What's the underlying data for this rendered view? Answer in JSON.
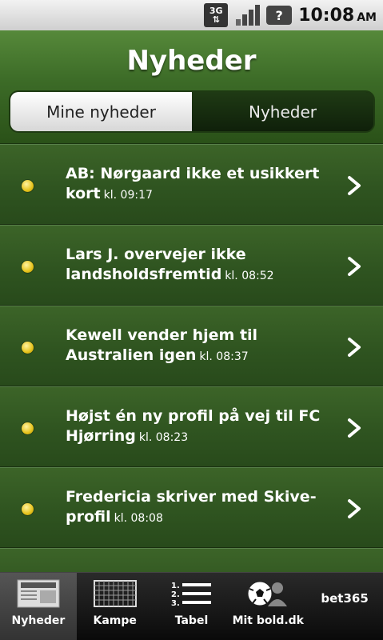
{
  "status": {
    "network": "3G",
    "battery_icon": "battery-unknown-icon",
    "time": "10:08",
    "ampm": "AM"
  },
  "header": {
    "title": "Nyheder",
    "segments": [
      "Mine nyheder",
      "Nyheder"
    ],
    "selected_segment": "Mine nyheder"
  },
  "news": [
    {
      "headline": "AB: Nørgaard ikke et usikkert kort",
      "time": "kl. 09:17"
    },
    {
      "headline": "Lars J. overvejer ikke landsholdsfremtid",
      "time": "kl. 08:52"
    },
    {
      "headline": "Kewell vender hjem til Australien igen",
      "time": "kl. 08:37"
    },
    {
      "headline": "Højst én ny profil på vej til FC Hjørring",
      "time": "kl. 08:23"
    },
    {
      "headline": "Fredericia skriver med Skive-profil",
      "time": "kl. 08:08"
    }
  ],
  "tabs": [
    {
      "label": "Nyheder",
      "icon": "newspaper-icon"
    },
    {
      "label": "Kampe",
      "icon": "goal-net-icon"
    },
    {
      "label": "Tabel",
      "icon": "numbered-list-icon"
    },
    {
      "label": "Mit bold.dk",
      "icon": "ball-profile-icon"
    }
  ],
  "sponsor": "bet365",
  "colors": {
    "header_green": "#3c6b27",
    "row_green": "#2f5420",
    "dot_yellow": "#e6c21b"
  }
}
